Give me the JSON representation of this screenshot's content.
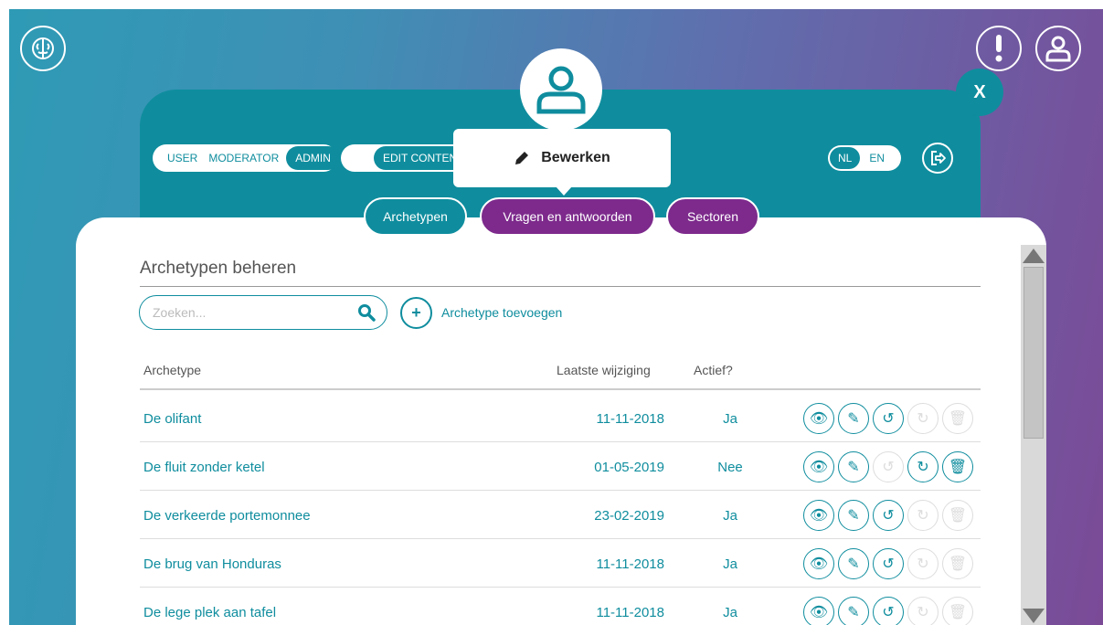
{
  "header": {
    "close_label": "X"
  },
  "roles": {
    "items": [
      "USER",
      "MODERATOR"
    ],
    "active": "ADMIN"
  },
  "edit_toggle": {
    "label": "EDIT CONTENT"
  },
  "tooltip": {
    "label": "Bewerken"
  },
  "language": {
    "active": "NL",
    "inactive": "EN"
  },
  "tabs": [
    {
      "label": "Archetypen"
    },
    {
      "label": "Vragen en antwoorden"
    },
    {
      "label": "Sectoren"
    }
  ],
  "main": {
    "title": "Archetypen beheren",
    "search_placeholder": "Zoeken...",
    "add_label": "Archetype toevoegen",
    "columns": {
      "name": "Archetype",
      "date": "Laatste wijziging",
      "active": "Actief?"
    },
    "rows": [
      {
        "name": "De olifant",
        "date": "11-11-2018",
        "active": "Ja"
      },
      {
        "name": "De fluit zonder ketel",
        "date": "01-05-2019",
        "active": "Nee"
      },
      {
        "name": "De verkeerde portemonnee",
        "date": "23-02-2019",
        "active": "Ja"
      },
      {
        "name": "De brug van Honduras",
        "date": "11-11-2018",
        "active": "Ja"
      },
      {
        "name": "De lege plek aan tafel",
        "date": "11-11-2018",
        "active": "Ja"
      }
    ]
  },
  "colors": {
    "teal": "#0f8d9e",
    "purple": "#7d2a8c"
  }
}
